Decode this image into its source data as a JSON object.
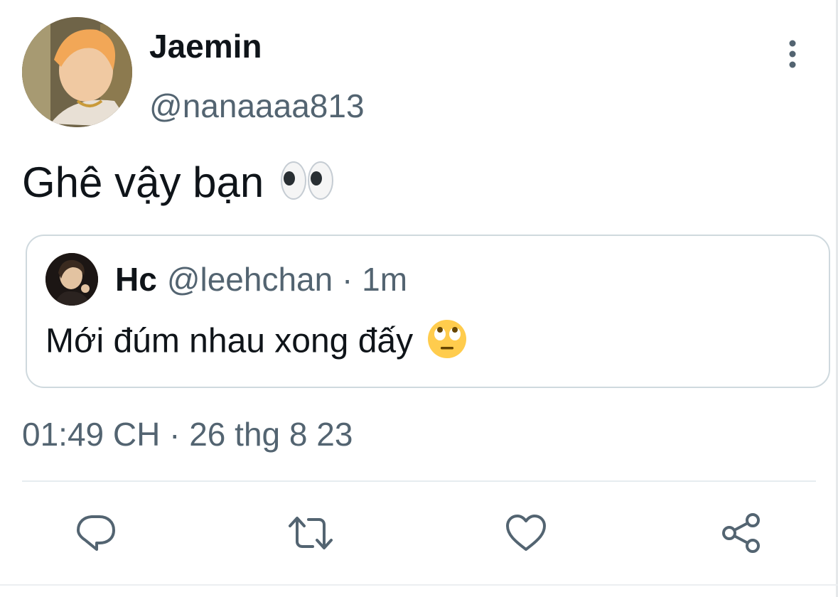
{
  "tweet": {
    "author_name": "Jaemin",
    "author_handle": "@nanaaaa813",
    "text": "Ghê vậy bạn",
    "text_emoji": "eyes-emoji",
    "timestamp": "01:49 CH · 26 thg 8 23"
  },
  "quoted_tweet": {
    "author_name": "Hc",
    "author_handle": "@leehchan",
    "separator": " · ",
    "time": "1m",
    "text": "Mới đúm nhau xong đấy",
    "text_emoji": "face-with-rolling-eyes-emoji"
  },
  "actions": [
    {
      "name": "reply",
      "icon": "reply-icon"
    },
    {
      "name": "retweet",
      "icon": "retweet-icon"
    },
    {
      "name": "like",
      "icon": "heart-icon"
    },
    {
      "name": "share",
      "icon": "share-icon"
    }
  ],
  "colors": {
    "text_primary": "#0f1419",
    "text_secondary": "#536471",
    "border": "#cfd9de"
  }
}
